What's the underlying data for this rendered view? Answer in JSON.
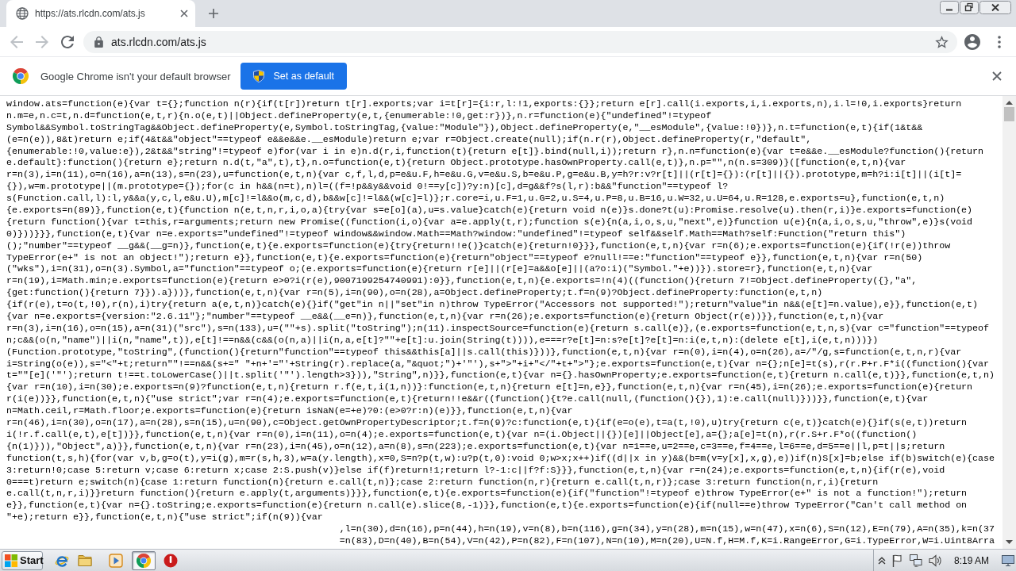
{
  "tabs": [
    {
      "title": "https://ats.rlcdn.com/ats.js",
      "selected": true
    }
  ],
  "toolbar": {
    "nav": [
      {
        "kind": "back",
        "disabled": true
      },
      {
        "kind": "forward",
        "disabled": true
      },
      {
        "kind": "reload",
        "disabled": false
      }
    ],
    "address": "ats.rlcdn.com/ats.js"
  },
  "infobar": {
    "message": "Google Chrome isn't your default browser",
    "button": "Set as default"
  },
  "document": {
    "lines": [
      {
        "kind": "full",
        "text": "window.ats=function(e){var t={};function n(r){if(t[r])return t[r].exports;var i=t[r]={i:r,l:!1,exports:{}};return e[r].call(i.exports,i,i.exports,n),i.l=!0,i.exports}return"
      },
      {
        "kind": "full",
        "text": "n.m=e,n.c=t,n.d=function(e,t,r){n.o(e,t)||Object.defineProperty(e,t,{enumerable:!0,get:r})},n.r=function(e){\"undefined\"!=typeof"
      },
      {
        "kind": "full",
        "text": "Symbol&&Symbol.toStringTag&&Object.defineProperty(e,Symbol.toStringTag,{value:\"Module\"}),Object.defineProperty(e,\"__esModule\",{value:!0})},n.t=function(e,t){if(1&t&&"
      },
      {
        "kind": "full",
        "text": "(e=n(e)),8&t)return e;if(4&t&&\"object\"==typeof e&&e&&e.__esModule)return e;var r=Object.create(null);if(n.r(r),Object.defineProperty(r,\"default\","
      },
      {
        "kind": "full",
        "text": "{enumerable:!0,value:e}),2&t&&\"string\"!=typeof e)for(var i in e)n.d(r,i,function(t){return e[t]}.bind(null,i));return r},n.n=function(e){var t=e&&e.__esModule?function(){return"
      },
      {
        "kind": "full",
        "text": "e.default}:function(){return e};return n.d(t,\"a\",t),t},n.o=function(e,t){return Object.prototype.hasOwnProperty.call(e,t)},n.p=\"\",n(n.s=309)}([function(e,t,n){var"
      },
      {
        "kind": "full",
        "text": "r=n(3),i=n(11),o=n(16),a=n(13),s=n(23),u=function(e,t,n){var c,f,l,d,p=e&u.F,h=e&u.G,v=e&u.S,b=e&u.P,g=e&u.B,y=h?r:v?r[t]||(r[t]={}):(r[t]||{}).prototype,m=h?i:i[t]||(i[t]="
      },
      {
        "kind": "full",
        "text": "{}),w=m.prototype||(m.prototype={});for(c in h&&(n=t),n)l=((f=!p&&y&&void 0!==y[c])?y:n)[c],d=g&&f?s(l,r):b&&\"function\"==typeof l?"
      },
      {
        "kind": "full",
        "text": "s(Function.call,l):l,y&&a(y,c,l,e&u.U),m[c]!=l&&o(m,c,d),b&&w[c]!=l&&(w[c]=l)};r.core=i,u.F=1,u.G=2,u.S=4,u.P=8,u.B=16,u.W=32,u.U=64,u.R=128,e.exports=u},function(e,t,n)"
      },
      {
        "kind": "full",
        "text": "{e.exports=n(89)},function(e,t){function n(e,t,n,r,i,o,a){try{var s=e[o](a),u=s.value}catch(e){return void n(e)}s.done?t(u):Promise.resolve(u).then(r,i)}e.exports=function(e)"
      },
      {
        "kind": "full",
        "text": "{return function(){var t=this,r=arguments;return new Promise((function(i,o){var a=e.apply(t,r);function s(e){n(a,i,o,s,u,\"next\",e)}function u(e){n(a,i,o,s,u,\"throw\",e)}s(void"
      },
      {
        "kind": "full",
        "text": "0)}))}}},function(e,t){var n=e.exports=\"undefined\"!=typeof window&&window.Math==Math?window:\"undefined\"!=typeof self&&self.Math==Math?self:Function(\"return this\")"
      },
      {
        "kind": "full",
        "text": "();\"number\"==typeof __g&&(__g=n)},function(e,t){e.exports=function(e){try{return!!e()}catch(e){return!0}}},function(e,t,n){var r=n(6);e.exports=function(e){if(!r(e))throw"
      },
      {
        "kind": "full",
        "text": "TypeError(e+\" is not an object!\");return e}},function(e,t){e.exports=function(e){return\"object\"==typeof e?null!==e:\"function\"==typeof e}},function(e,t,n){var r=n(50)"
      },
      {
        "kind": "full",
        "text": "(\"wks\"),i=n(31),o=n(3).Symbol,a=\"function\"==typeof o;(e.exports=function(e){return r[e]||(r[e]=a&&o[e]||(a?o:i)(\"Symbol.\"+e))}).store=r},function(e,t,n){var"
      },
      {
        "kind": "full",
        "text": "r=n(19),i=Math.min;e.exports=function(e){return e>0?i(r(e),9007199254740991):0}},function(e,t,n){e.exports=!n(4)((function(){return 7!=Object.defineProperty({},\"a\","
      },
      {
        "kind": "full",
        "text": "{get:function(){return 7}}).a}))},function(e,t,n){var r=n(5),i=n(90),o=n(28),a=Object.defineProperty;t.f=n(9)?Object.defineProperty:function(e,t,n)"
      },
      {
        "kind": "full",
        "text": "{if(r(e),t=o(t,!0),r(n),i)try{return a(e,t,n)}catch(e){}if(\"get\"in n||\"set\"in n)throw TypeError(\"Accessors not supported!\");return\"value\"in n&&(e[t]=n.value),e}},function(e,t)"
      },
      {
        "kind": "full",
        "text": "{var n=e.exports={version:\"2.6.11\"};\"number\"==typeof __e&&(__e=n)},function(e,t,n){var r=n(26);e.exports=function(e){return Object(r(e))}},function(e,t,n){var"
      },
      {
        "kind": "full",
        "text": "r=n(3),i=n(16),o=n(15),a=n(31)(\"src\"),s=n(133),u=(\"\"+s).split(\"toString\");n(11).inspectSource=function(e){return s.call(e)},(e.exports=function(e,t,n,s){var c=\"function\"==typeof"
      },
      {
        "kind": "full",
        "text": "n;c&&(o(n,\"name\")||i(n,\"name\",t)),e[t]!==n&&(c&&(o(n,a)||i(n,a,e[t]?\"\"+e[t]:u.join(String(t)))),e===r?e[t]=n:s?e[t]?e[t]=n:i(e,t,n):(delete e[t],i(e,t,n)))})"
      },
      {
        "kind": "full",
        "text": "(Function.prototype,\"toString\",(function(){return\"function\"==typeof this&&this[a]||s.call(this)}))},function(e,t,n){var r=n(0),i=n(4),o=n(26),a=/\"/g,s=function(e,t,n,r){var"
      },
      {
        "kind": "full",
        "text": "i=String(o(e)),s=\"<\"+t;return\"\"!==n&&(s+=\" \"+n+'=\"'+String(r).replace(a,\"&quot;\")+'\"'),s+\">\"+i+\"</\"+t+\">\"};e.exports=function(e,t){var n={};n[e]=t(s),r(r.P+r.F*i((function(){var"
      },
      {
        "kind": "full",
        "text": "t=\"\"[e]('\"');return t!==t.toLowerCase()||t.split('\"').length>3})),\"String\",n)}},function(e,t){var n={}.hasOwnProperty;e.exports=function(e,t){return n.call(e,t)}},function(e,t,n)"
      },
      {
        "kind": "full",
        "text": "{var r=n(10),i=n(30);e.exports=n(9)?function(e,t,n){return r.f(e,t,i(1,n))}:function(e,t,n){return e[t]=n,e}},function(e,t,n){var r=n(45),i=n(26);e.exports=function(e){return"
      },
      {
        "kind": "full",
        "text": "r(i(e))}},function(e,t,n){\"use strict\";var r=n(4);e.exports=function(e,t){return!!e&&r((function(){t?e.call(null,(function(){}),1):e.call(null)}))}},function(e,t){var"
      },
      {
        "kind": "full",
        "text": "n=Math.ceil,r=Math.floor;e.exports=function(e){return isNaN(e=+e)?0:(e>0?r:n)(e)}},function(e,t,n){var"
      },
      {
        "kind": "full",
        "text": "r=n(46),i=n(30),o=n(17),a=n(28),s=n(15),u=n(90),c=Object.getOwnPropertyDescriptor;t.f=n(9)?c:function(e,t){if(e=o(e),t=a(t,!0),u)try{return c(e,t)}catch(e){}if(s(e,t))return"
      },
      {
        "kind": "full",
        "text": "i(!r.f.call(e,t),e[t])}},function(e,t,n){var r=n(0),i=n(11),o=n(4);e.exports=function(e,t){var n=(i.Object||{})[e]||Object[e],a={};a[e]=t(n),r(r.S+r.F*o((function()"
      },
      {
        "kind": "full",
        "text": "{n(1)})),\"Object\",a)}},function(e,t,n){var r=n(23),i=n(45),o=n(12),a=n(8),s=n(223);e.exports=function(e,t){var n=1==e,u=2==e,c=3==e,f=4==e,l=6==e,d=5==e||l,p=t||s;return"
      },
      {
        "kind": "full",
        "text": "function(t,s,h){for(var v,b,g=o(t),y=i(g),m=r(s,h,3),w=a(y.length),x=0,S=n?p(t,w):u?p(t,0):void 0;w>x;x++)if((d||x in y)&&(b=m(v=y[x],x,g),e))if(n)S[x]=b;else if(b)switch(e){case"
      },
      {
        "kind": "full",
        "text": "3:return!0;case 5:return v;case 6:return x;case 2:S.push(v)}else if(f)return!1;return l?-1:c||f?f:S}}},function(e,t,n){var r=n(24);e.exports=function(e,t,n){if(r(e),void"
      },
      {
        "kind": "full",
        "text": "0===t)return e;switch(n){case 1:return function(n){return e.call(t,n)};case 2:return function(n,r){return e.call(t,n,r)};case 3:return function(n,r,i){return"
      },
      {
        "kind": "full",
        "text": "e.call(t,n,r,i)}}return function(){return e.apply(t,arguments)}}},function(e,t){e.exports=function(e){if(\"function\"!=typeof e)throw TypeError(e+\" is not a function!\");return"
      },
      {
        "kind": "full",
        "text": "e}},function(e,t){var n={}.toString;e.exports=function(e){return n.call(e).slice(8,-1)}},function(e,t){e.exports=function(e){if(null==e)throw TypeError(\"Can't call method on"
      },
      {
        "kind": "full",
        "text": "\"+e);return e}},function(e,t,n){\"use strict\";if(n(9)){var"
      },
      {
        "kind": "fragment",
        "text": ",l=n(30),d=n(16),p=n(44),h=n(19),v=n(8),b=n(116),g=n(34),y=n(28),m=n(15),w=n(47),x=n(6),S=n(12),E=n(79),A=n(35),k=n(37"
      },
      {
        "kind": "fragment",
        "text": "=n(83),D=n(40),B=n(54),V=n(42),P=n(82),F=n(107),N=n(10),M=n(20),U=N.f,H=M.f,K=i.RangeError,G=i.TypeError,W=i.Uint8Arra"
      }
    ]
  },
  "taskbar": {
    "start": "Start",
    "apps": [
      {
        "kind": "browser-e",
        "selected": false
      },
      {
        "kind": "folder",
        "selected": false
      },
      {
        "kind": "media",
        "selected": false
      },
      {
        "kind": "round-logo",
        "selected": true
      },
      {
        "kind": "alert",
        "selected": false
      }
    ],
    "clock": "8:19 AM"
  }
}
